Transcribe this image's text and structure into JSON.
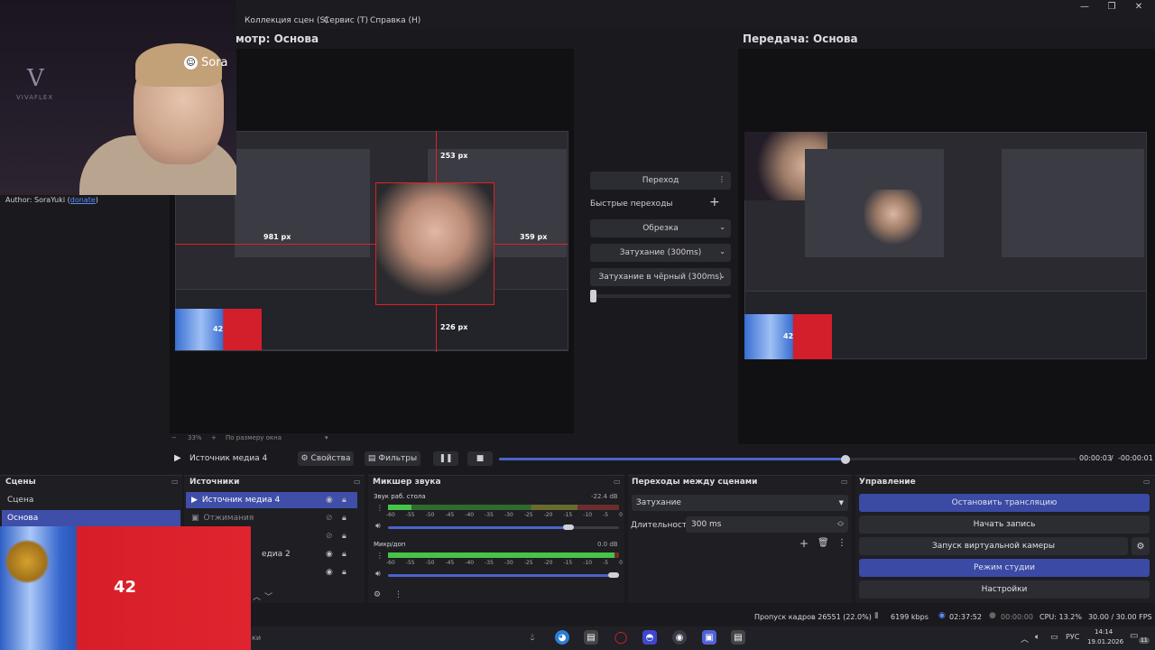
{
  "menu": {
    "items": [
      "Коллекция сцен (S)",
      "Сервис (Т)",
      "Справка (Н)"
    ]
  },
  "window_controls": {
    "minimize": "—",
    "restore": "❐",
    "close": "✕"
  },
  "webcam": {
    "badge": "Sora",
    "logo_letter": "V",
    "logo_text": "VIVAFLEX"
  },
  "author": {
    "prefix": "Author: SoraYuki (",
    "link": "donate",
    "suffix": ")"
  },
  "preview": {
    "left_title": "мотр: Основа",
    "right_title": "Передача: Основа",
    "measures": {
      "top": "253 px",
      "left": "981 px",
      "right": "359 px",
      "bottom": "226 px"
    },
    "nested_number": "42"
  },
  "transitions_panel": {
    "transition_button": "Переход",
    "quick_label": "Быстрые переходы",
    "quick_items": [
      "Обрезка",
      "Затухание (300ms)",
      "Затухание в чёрный (300ms)"
    ]
  },
  "zoom": {
    "percent": "33%",
    "fit_label": "По размеру окна"
  },
  "media": {
    "source_name": "Источник медиа 4",
    "properties": "Свойства",
    "filters": "Фильтры",
    "time_current": "00:00:03",
    "time_separator": "/",
    "time_remaining": "-00:00:01",
    "progress_fraction": 0.6
  },
  "scenes": {
    "title": "Сцены",
    "items": [
      "Сцена",
      "Основа"
    ],
    "selected_index": 1
  },
  "sources": {
    "title": "Источники",
    "items": [
      "Источник медиа 4",
      "Отжимания",
      "",
      "едиа 2",
      ""
    ]
  },
  "mixer": {
    "title": "Микшер звука",
    "channels": [
      {
        "name": "Звук раб. стола",
        "db": "-22.4 dB",
        "level": 0.1,
        "volume": 0.78
      },
      {
        "name": "Микр/доп",
        "db": "0.0 dB",
        "level": 0.98,
        "volume": 1.0
      }
    ],
    "ticks": [
      "-60",
      "-55",
      "-50",
      "-45",
      "-40",
      "-35",
      "-30",
      "-25",
      "-20",
      "-15",
      "-10",
      "-5",
      "0"
    ]
  },
  "scene_transitions": {
    "title": "Переходы между сценами",
    "selected": "Затухание",
    "duration_label": "Длительность",
    "duration_value": "300 ms"
  },
  "controls": {
    "title": "Управление",
    "stop_stream": "Остановить трансляцию",
    "start_record": "Начать запись",
    "virtual_cam": "Запуск виртуальной камеры",
    "studio_mode": "Режим студии",
    "settings": "Настройки"
  },
  "status": {
    "dropped": "Пропуск кадров 26551 (22.0%)",
    "bitrate": "6199 kbps",
    "stream_time": "02:37:52",
    "record_time": "00:00:00",
    "cpu": "CPU: 13.2%",
    "fps": "30.00 / 30.00 FPS"
  },
  "taskbar": {
    "lang": "РУС",
    "time": "14:14",
    "date": "19.01.2026",
    "notif_count": "11"
  },
  "overlay_flag": {
    "number": "42",
    "tail_text": "ки"
  },
  "colors": {
    "accent": "#3b4aa5",
    "selected": "#3f4ea8",
    "flag_red": "#d71e28",
    "flag_blue": "#2e5fc4"
  }
}
